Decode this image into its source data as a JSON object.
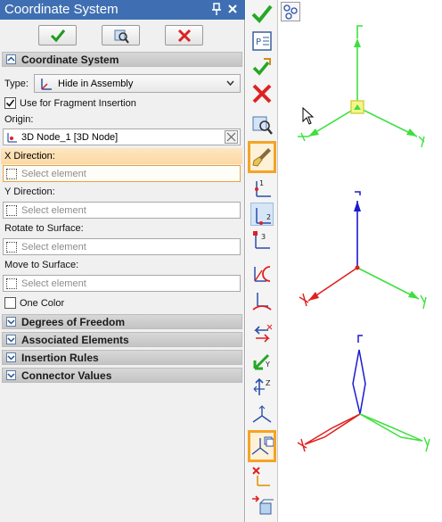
{
  "panel": {
    "title": "Coordinate System",
    "buttons": {
      "ok": "ok-check-icon",
      "preview": "preview-icon",
      "cancel": "cancel-x-icon"
    }
  },
  "sections": {
    "coordinate_system": "Coordinate System",
    "degrees_of_freedom": "Degrees of Freedom",
    "associated_elements": "Associated Elements",
    "insertion_rules": "Insertion Rules",
    "connector_values": "Connector Values"
  },
  "form": {
    "type_label": "Type:",
    "type_value": "Hide in Assembly",
    "use_fragment_label": "Use for Fragment Insertion",
    "use_fragment_checked": true,
    "origin_label": "Origin:",
    "origin_value": "3D Node_1 [3D Node]",
    "x_direction_label": "X Direction:",
    "x_direction_placeholder": "Select element",
    "y_direction_label": "Y Direction:",
    "y_direction_placeholder": "Select element",
    "rotate_label": "Rotate to Surface:",
    "rotate_placeholder": "Select element",
    "move_label": "Move to Surface:",
    "move_placeholder": "Select element",
    "one_color_label": "One Color",
    "one_color_checked": false
  },
  "colors": {
    "title_bar": "#3f6fb2",
    "highlight": "#f4a425",
    "axis_green": "#3ee03e",
    "axis_red": "#e02020",
    "axis_blue": "#1a1ad0"
  }
}
